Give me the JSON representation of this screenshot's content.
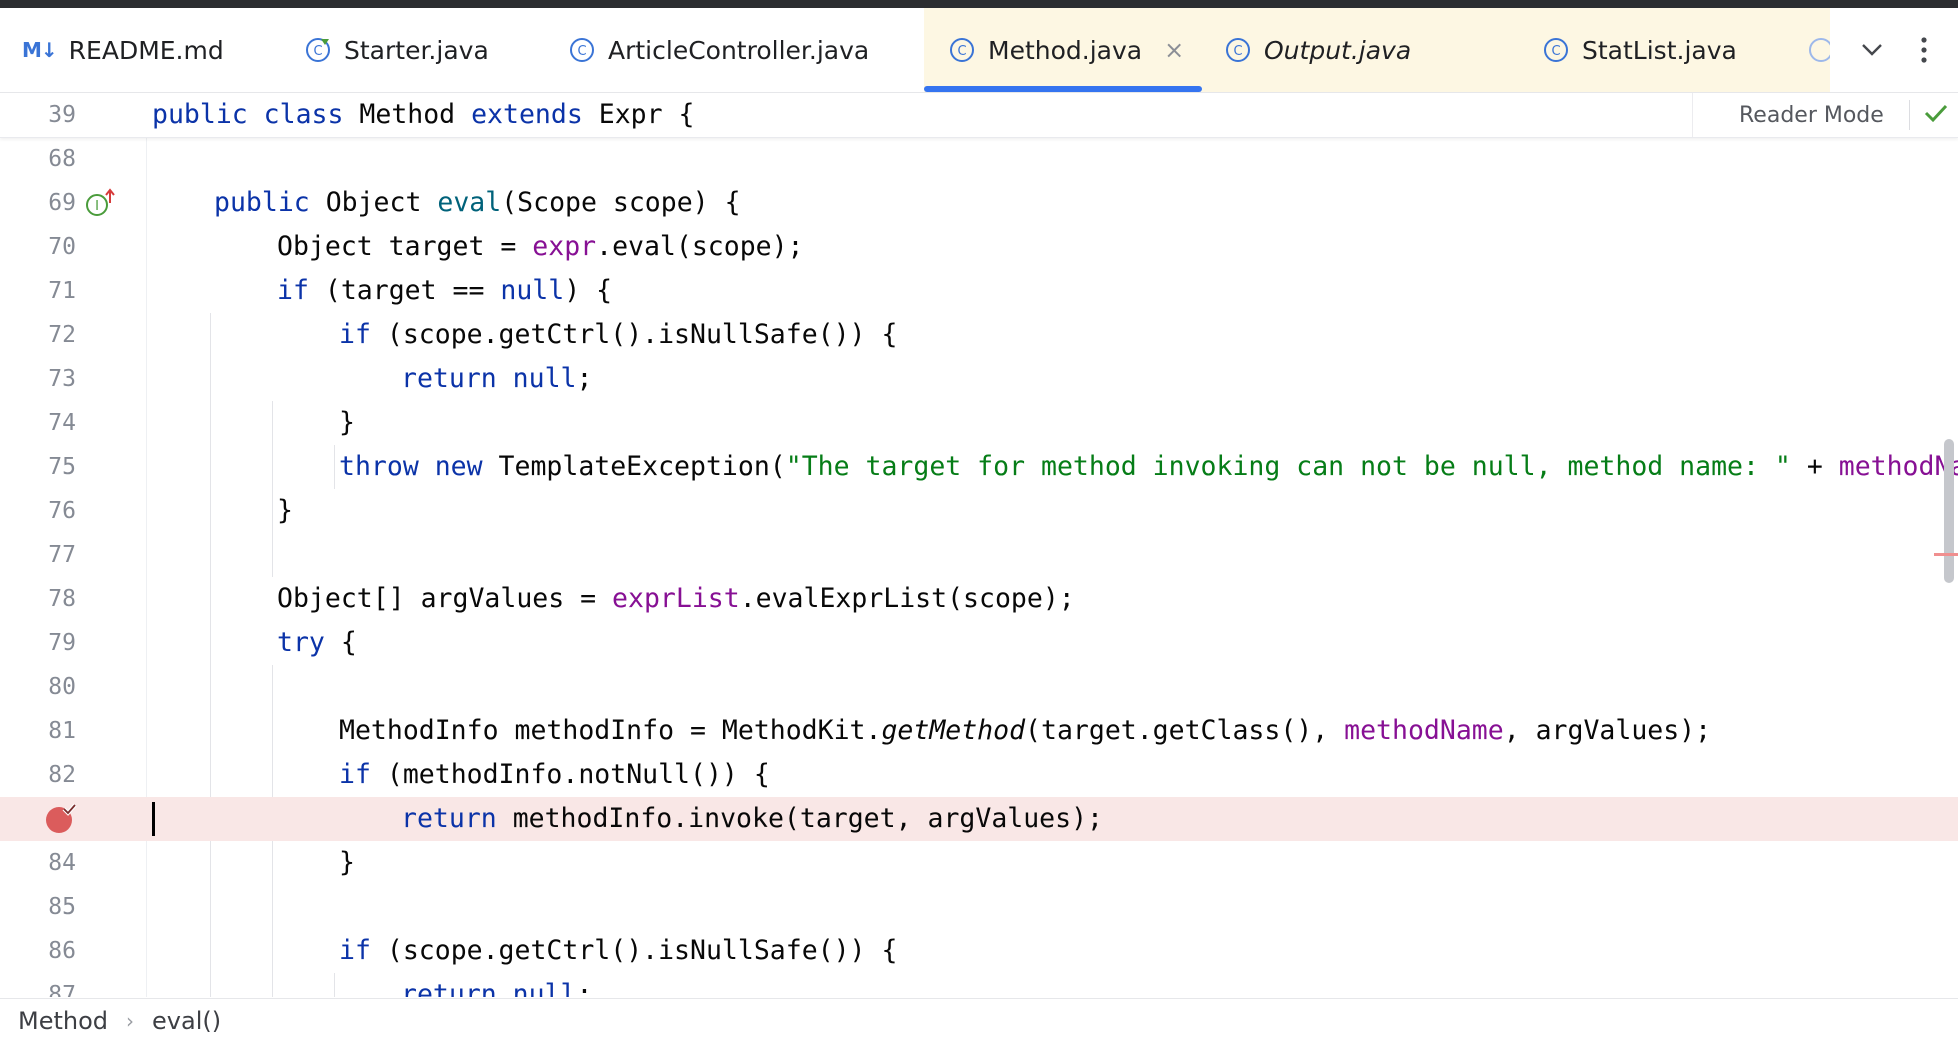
{
  "tabs": [
    {
      "label": "README.md",
      "icon": "markdown-icon",
      "italic": false,
      "active": false
    },
    {
      "label": "Starter.java",
      "icon": "java-run-class-icon",
      "italic": false,
      "active": false
    },
    {
      "label": "ArticleController.java",
      "icon": "java-class-icon",
      "italic": false,
      "active": false
    },
    {
      "label": "Method.java",
      "icon": "java-class-icon",
      "italic": false,
      "active": true,
      "close": "×"
    },
    {
      "label": "Output.java",
      "icon": "java-class-icon",
      "italic": true,
      "active": false
    },
    {
      "label": "StatList.java",
      "icon": "java-class-icon",
      "italic": false,
      "active": false
    }
  ],
  "reader_mode_label": "Reader Mode",
  "sticky": {
    "line_no": "39"
  },
  "line_numbers": [
    "68",
    "69",
    "70",
    "71",
    "72",
    "73",
    "74",
    "75",
    "76",
    "77",
    "78",
    "79",
    "80",
    "81",
    "82",
    "83",
    "84",
    "85",
    "86",
    "87"
  ],
  "code_strings": {
    "exception_message": "\"The target for method invoking can not be null, method name: \""
  },
  "breadcrumb": {
    "items": [
      "Method",
      "eval()"
    ],
    "separator": "›"
  },
  "colors": {
    "keyword": "#0b33a8",
    "field": "#871094",
    "method_decl": "#00627a",
    "string": "#067d17",
    "active_tab_underline": "#3574f0",
    "breakpoint": "#db5c5c",
    "highlight_line": "#f9e7e6"
  }
}
